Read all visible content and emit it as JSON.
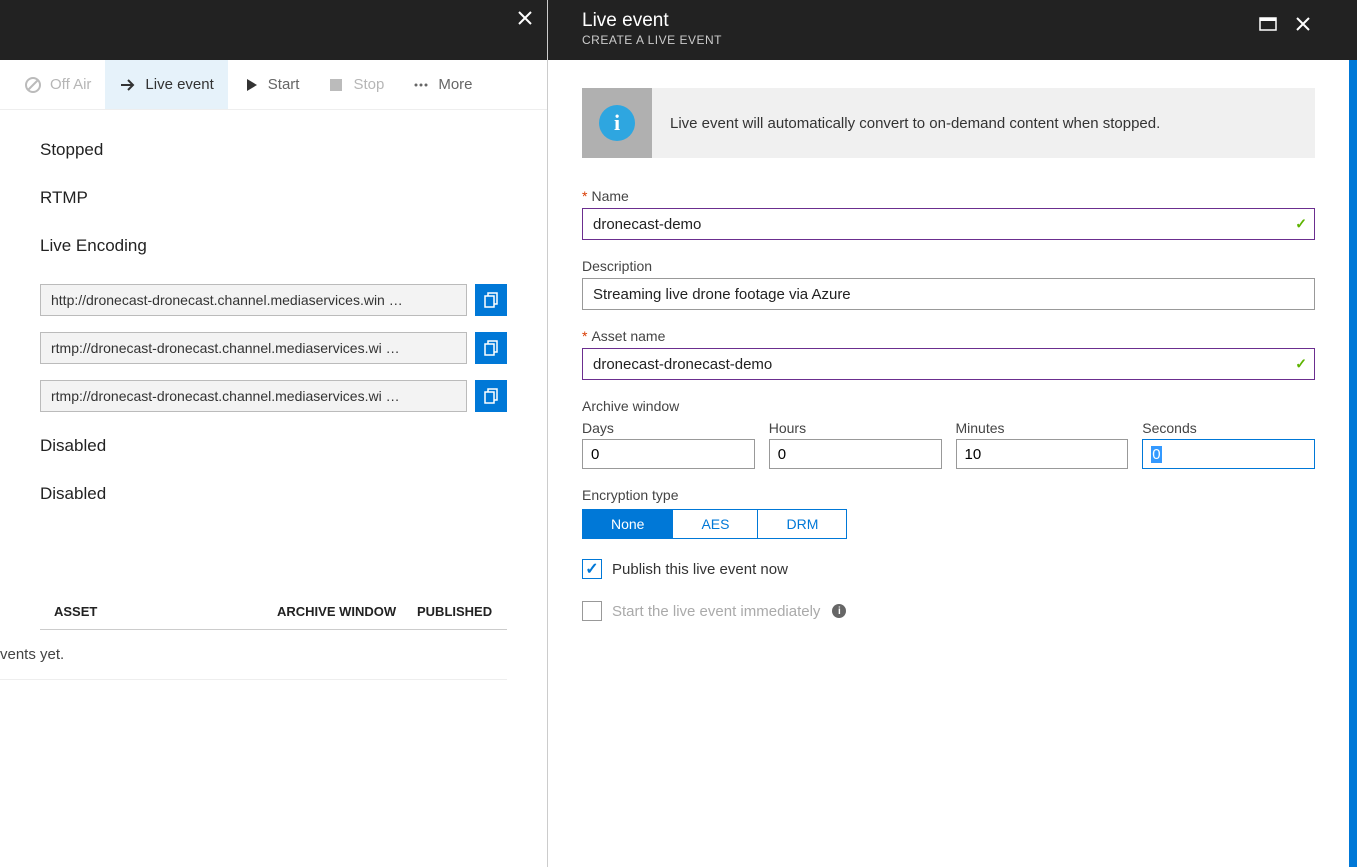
{
  "left": {
    "toolbar": {
      "offair": "Off Air",
      "liveevent": "Live event",
      "start": "Start",
      "stop": "Stop",
      "more": "More"
    },
    "status": "Stopped",
    "protocol": "RTMP",
    "encoding": "Live Encoding",
    "urls": [
      "http://dronecast-dronecast.channel.mediaservices.win …",
      "rtmp://dronecast-dronecast.channel.mediaservices.wi …",
      "rtmp://dronecast-dronecast.channel.mediaservices.wi …"
    ],
    "disabled1": "Disabled",
    "disabled2": "Disabled",
    "table": {
      "col1": "ASSET",
      "col2": "ARCHIVE WINDOW",
      "col3": "PUBLISHED",
      "empty": "vents yet."
    }
  },
  "right": {
    "title": "Live event",
    "subtitle": "CREATE A LIVE EVENT",
    "info": "Live event will automatically convert to on-demand content when stopped.",
    "name_label": "Name",
    "name_value": "dronecast-demo",
    "desc_label": "Description",
    "desc_value": "Streaming live drone footage via Azure",
    "asset_label": "Asset name",
    "asset_value": "dronecast-dronecast-demo",
    "archive_label": "Archive window",
    "time": {
      "days_label": "Days",
      "days": "0",
      "hours_label": "Hours",
      "hours": "0",
      "minutes_label": "Minutes",
      "minutes": "10",
      "seconds_label": "Seconds",
      "seconds": "0"
    },
    "encryption_label": "Encryption type",
    "encryption": {
      "none": "None",
      "aes": "AES",
      "drm": "DRM"
    },
    "publish_label": "Publish this live event now",
    "start_now_label": "Start the live event immediately"
  }
}
